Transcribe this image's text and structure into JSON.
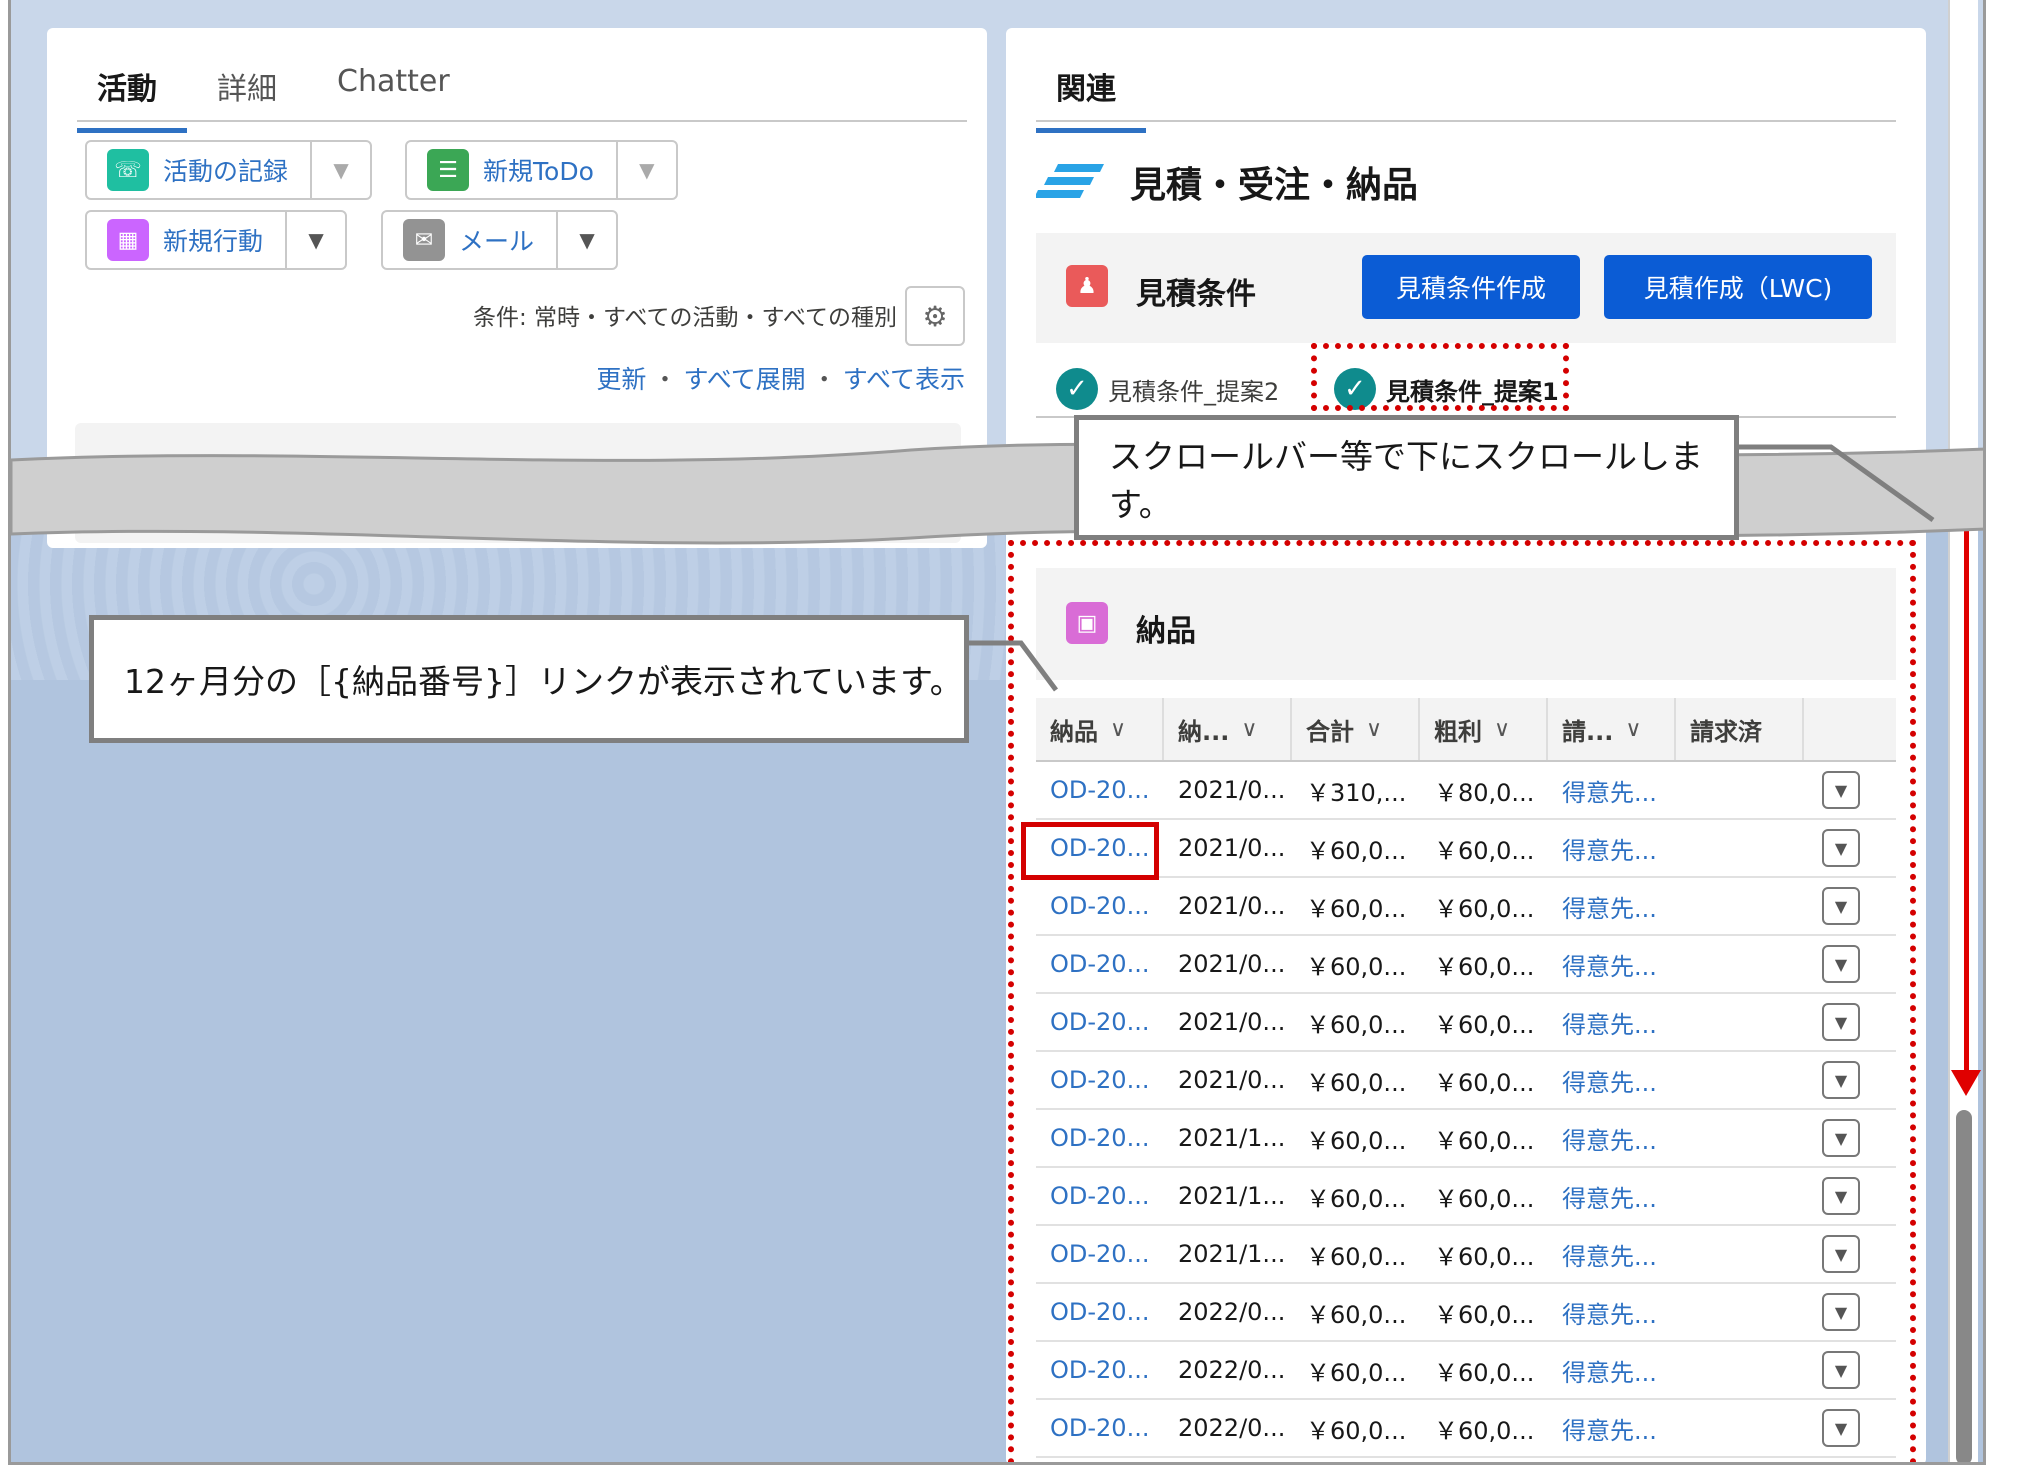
{
  "left_panel": {
    "tabs": [
      "活動",
      "詳細",
      "Chatter"
    ],
    "buttons": {
      "log_activity": "活動の記録",
      "new_todo": "新規ToDo",
      "new_event": "新規行動",
      "email": "メール"
    },
    "filter_text": "条件: 常時・すべての活動・すべての種別",
    "links": {
      "refresh": "更新",
      "expand_all": "すべて展開",
      "show_all": "すべて表示",
      "separator": "・"
    }
  },
  "right_panel": {
    "tab": "関連",
    "section_title": "見積・受注・納品",
    "quote_card": {
      "title": "見積条件",
      "button_create_condition": "見積条件作成",
      "button_create_quote": "見積作成（LWC)"
    },
    "quote_tabs": [
      "見積条件_提案2",
      "見積条件_提案1"
    ],
    "delivery_card": {
      "title": "納品",
      "columns": [
        "納品",
        "納...",
        "合計",
        "粗利",
        "請...",
        "請求済"
      ],
      "rows": [
        [
          "OD-20...",
          "2021/0...",
          "￥310,...",
          "￥80,0...",
          "得意先..."
        ],
        [
          "OD-20...",
          "2021/0...",
          "￥60,0...",
          "￥60,0...",
          "得意先..."
        ],
        [
          "OD-20...",
          "2021/0...",
          "￥60,0...",
          "￥60,0...",
          "得意先..."
        ],
        [
          "OD-20...",
          "2021/0...",
          "￥60,0...",
          "￥60,0...",
          "得意先..."
        ],
        [
          "OD-20...",
          "2021/0...",
          "￥60,0...",
          "￥60,0...",
          "得意先..."
        ],
        [
          "OD-20...",
          "2021/0...",
          "￥60,0...",
          "￥60,0...",
          "得意先..."
        ],
        [
          "OD-20...",
          "2021/1...",
          "￥60,0...",
          "￥60,0...",
          "得意先..."
        ],
        [
          "OD-20...",
          "2021/1...",
          "￥60,0...",
          "￥60,0...",
          "得意先..."
        ],
        [
          "OD-20...",
          "2021/1...",
          "￥60,0...",
          "￥60,0...",
          "得意先..."
        ],
        [
          "OD-20...",
          "2022/0...",
          "￥60,0...",
          "￥60,0...",
          "得意先..."
        ],
        [
          "OD-20...",
          "2022/0...",
          "￥60,0...",
          "￥60,0...",
          "得意先..."
        ],
        [
          "OD-20...",
          "2022/0...",
          "￥60,0...",
          "￥60,0...",
          "得意先..."
        ]
      ]
    }
  },
  "callouts": {
    "scroll": "スクロールバー等で下にスクロールします。",
    "links": "12ヶ月分の［{納品番号}］リンクが表示されています。"
  },
  "colors": {
    "brand_button": "#0b5cd5",
    "link": "#2e71c3",
    "highlight": "#d40000",
    "check": "#0f8b8d"
  }
}
